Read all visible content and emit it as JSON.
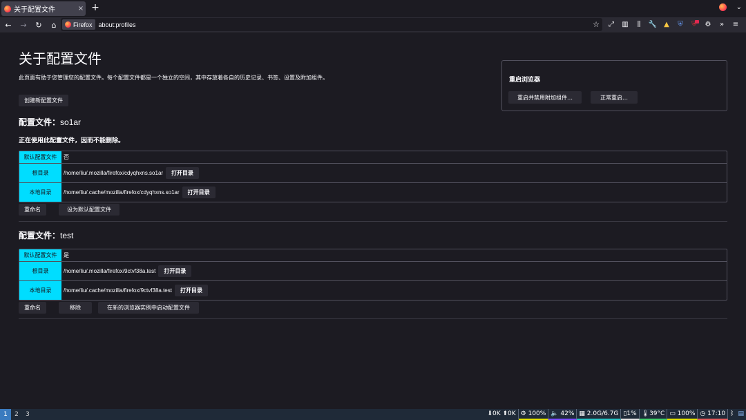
{
  "browser": {
    "tab_title": "关于配置文件",
    "tab_close": "×",
    "new_tab": "+",
    "identity_label": "Firefox",
    "url": "about:profiles"
  },
  "page": {
    "title": "关于配置文件",
    "intro": "此页面有助于您管理您的配置文件。每个配置文件都是一个独立的空间，其中存放着各自的历史记录、书签、设置及附加组件。",
    "create_button": "创建新配置文件",
    "restart": {
      "title": "重启浏览器",
      "restart_disabled_addons": "重启并禁用附加组件…",
      "restart_normal": "正常重启…"
    },
    "labels": {
      "default_profile": "默认配置文件",
      "root_dir": "根目录",
      "local_dir": "本地目录",
      "open_dir": "打开目录",
      "rename": "重命名",
      "set_default": "设为默认配置文件",
      "remove": "移除",
      "launch_new": "在新的浏览器实例中启动配置文件",
      "profile_prefix": "配置文件："
    },
    "profiles": [
      {
        "name": "so1ar",
        "in_use_note": "正在使用此配置文件，因而不能删除。",
        "default": "否",
        "root_dir": "/home/liu/.mozilla/firefox/cdyqhxns.so1ar",
        "local_dir": "/home/liu/.cache/mozilla/firefox/cdyqhxns.so1ar"
      },
      {
        "name": "test",
        "default": "是",
        "root_dir": "/home/liu/.mozilla/firefox/9ctvf38a.test",
        "local_dir": "/home/liu/.cache/mozilla/firefox/9ctvf38a.test"
      }
    ]
  },
  "taskbar": {
    "workspaces": [
      "1",
      "2",
      "3"
    ],
    "net": "⬇0K ⬆0K",
    "cpu": "⚙ 100%",
    "volume": "🔈 42%",
    "memory": "▦ 2.0G/6.7G",
    "disk": "▯1%",
    "temp": "🌡39°C",
    "battery": "▭ 100%",
    "clock": "◷ 17:10",
    "bluetooth": "ᛒ",
    "colors": {
      "accent": "#00ddff",
      "workspace_active": "#3b7bbf"
    }
  }
}
